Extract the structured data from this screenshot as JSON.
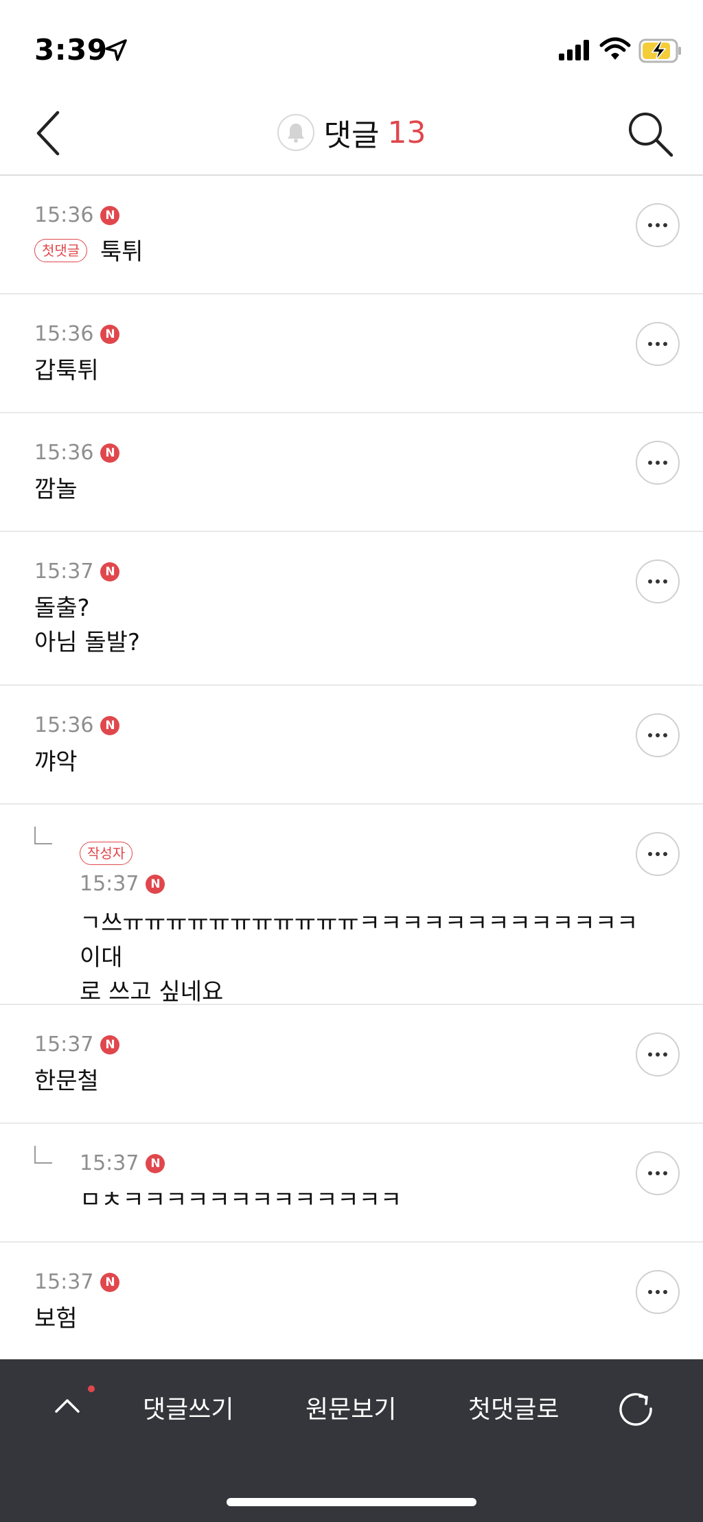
{
  "status_bar": {
    "time": "3:39"
  },
  "header": {
    "title": "댓글",
    "count": "13"
  },
  "comments": [
    {
      "time": "15:36",
      "badge": "N",
      "tag": "첫댓글",
      "text": "툭튀"
    },
    {
      "time": "15:36",
      "badge": "N",
      "text": "갑툭튀"
    },
    {
      "time": "15:36",
      "badge": "N",
      "text": "깜놀"
    },
    {
      "time": "15:37",
      "badge": "N",
      "text": "돌출?\n아님 돌발?"
    },
    {
      "time": "15:36",
      "badge": "N",
      "text": "꺄악"
    },
    {
      "time": "15:37",
      "badge": "N",
      "tag": "작성자",
      "text": "ㄱ쓰ㅠㅠㅠㅠㅠㅠㅠㅠㅠㅠㅠㅋㅋㅋㅋㅋㅋㅋㅋㅋㅋㅋㅋㅋ 이대\n로 쓰고 싶네요"
    },
    {
      "time": "15:37",
      "badge": "N",
      "text": "한문철"
    },
    {
      "time": "15:37",
      "badge": "N",
      "text": "ㅁㅊㅋㅋㅋㅋㅋㅋㅋㅋㅋㅋㅋㅋㅋ"
    },
    {
      "time": "15:37",
      "badge": "N",
      "text": "보험"
    }
  ],
  "bottom_bar": {
    "write_label": "댓글쓰기",
    "view_original_label": "원문보기",
    "first_comment_label": "첫댓글로"
  },
  "colors": {
    "accent": "#e0474c",
    "bottom_bar": "#35363b",
    "time_gray": "#8e8e8e"
  }
}
